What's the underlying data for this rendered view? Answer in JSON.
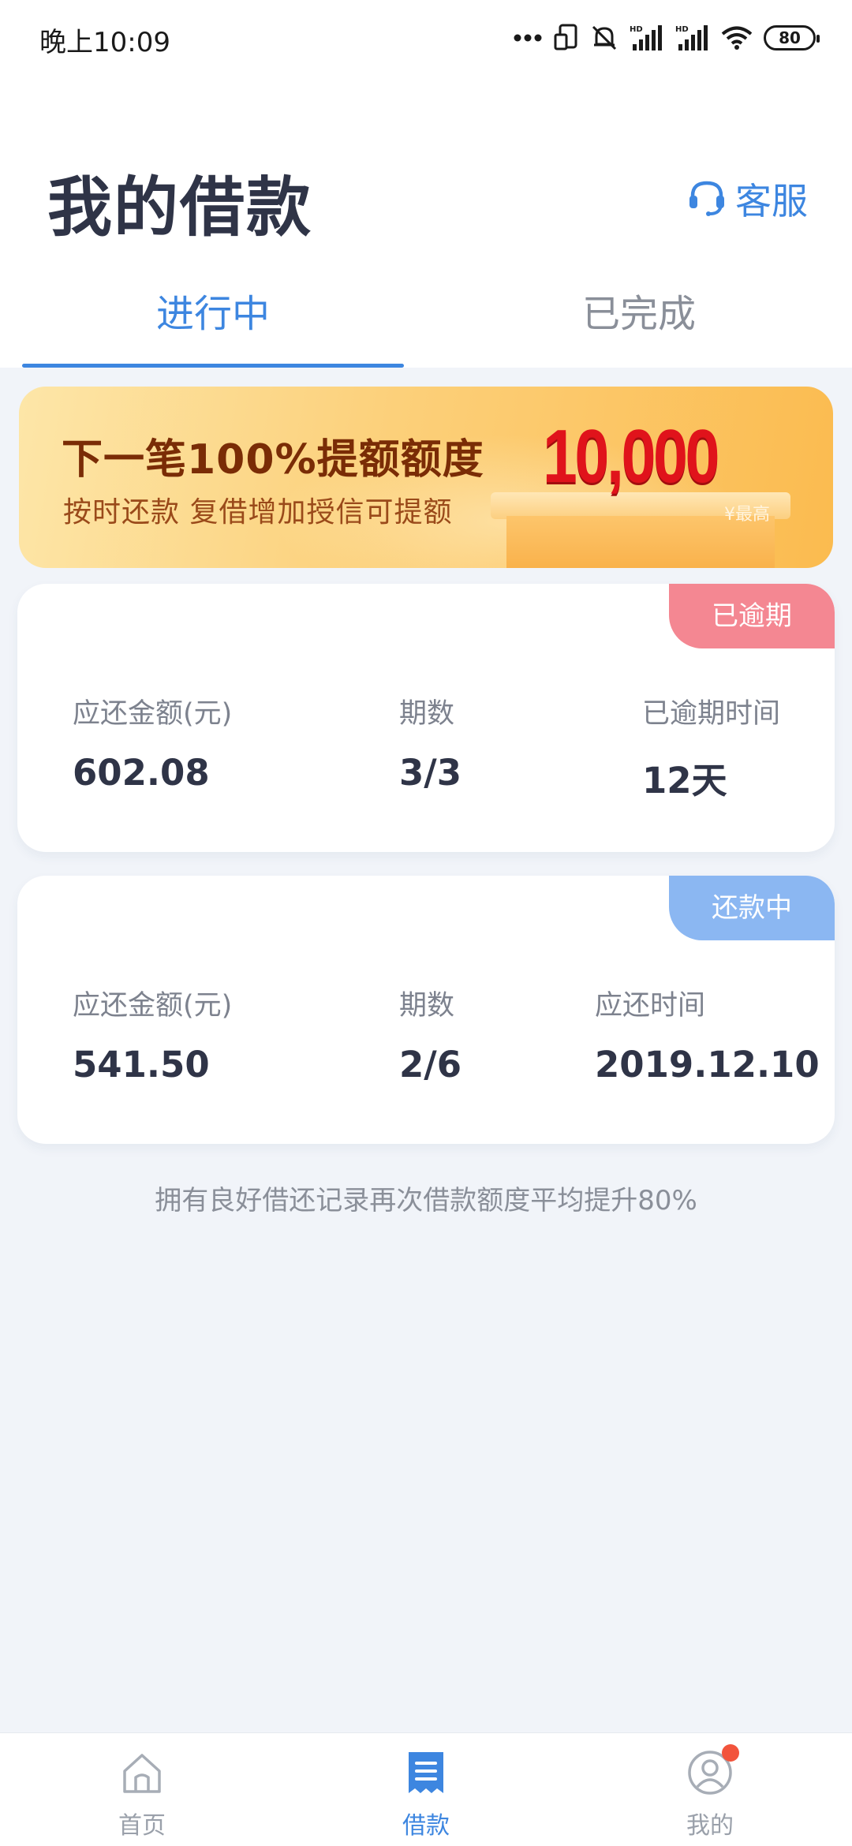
{
  "status_bar": {
    "time": "晚上10:09",
    "battery": "80"
  },
  "header": {
    "title": "我的借款",
    "service_label": "客服"
  },
  "tabs": [
    {
      "label": "进行中",
      "active": true
    },
    {
      "label": "已完成",
      "active": false
    }
  ],
  "banner": {
    "title": "下一笔100%提额额度",
    "subtitle": "按时还款  复借增加授信可提额",
    "amount": "10,000",
    "note": "¥最高"
  },
  "loans": [
    {
      "status": "已逾期",
      "fields": [
        {
          "label": "应还金额(元)",
          "value": "602.08"
        },
        {
          "label": "期数",
          "value": "3/3"
        },
        {
          "label": "已逾期时间",
          "value": "12天"
        }
      ]
    },
    {
      "status": "还款中",
      "fields": [
        {
          "label": "应还金额(元)",
          "value": "541.50"
        },
        {
          "label": "期数",
          "value": "2/6"
        },
        {
          "label": "应还时间",
          "value": "2019.12.10"
        }
      ]
    }
  ],
  "footer_note": "拥有良好借还记录再次借款额度平均提升80%",
  "bottom_nav": [
    {
      "label": "首页",
      "icon": "home-icon",
      "active": false
    },
    {
      "label": "借款",
      "icon": "loan-document-icon",
      "active": true
    },
    {
      "label": "我的",
      "icon": "user-profile-icon",
      "active": false
    }
  ],
  "colors": {
    "accent": "#3d86e0",
    "overdue": "#f48792",
    "repaying": "#8bb7f2",
    "banner_amount": "#e0131b"
  }
}
